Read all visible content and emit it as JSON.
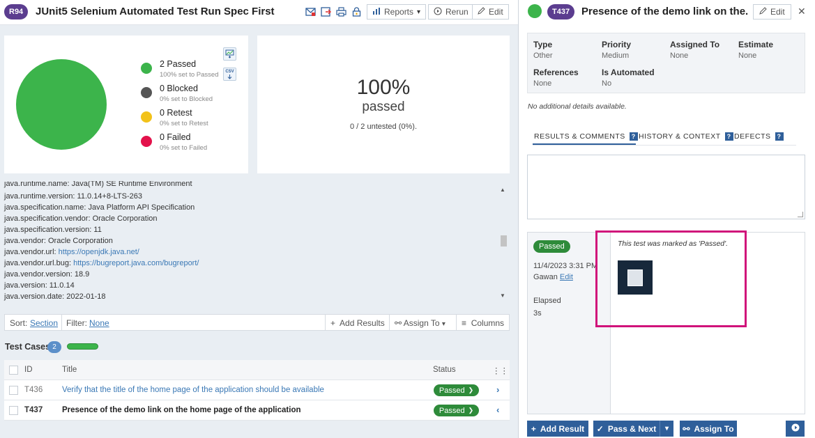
{
  "run": {
    "badge": "R94",
    "title": "JUnit5 Selenium Automated Test Run Spec First",
    "reports_label": "Reports",
    "rerun_label": "Rerun",
    "edit_label": "Edit"
  },
  "stats": {
    "legend": [
      {
        "label": "2 Passed",
        "sub": "100% set to Passed",
        "color": "#3cb44b"
      },
      {
        "label": "0 Blocked",
        "sub": "0% set to Blocked",
        "color": "#555555"
      },
      {
        "label": "0 Retest",
        "sub": "0% set to Retest",
        "color": "#f2c21a"
      },
      {
        "label": "0 Failed",
        "sub": "0% set to Failed",
        "color": "#e3124b"
      }
    ],
    "csv_label": "CSV",
    "percent": "100%",
    "percent_word": "passed",
    "untested": "0 / 2 untested (0%)."
  },
  "properties": [
    {
      "text": "java.runtime.name: Java(TM) SE Runtime Environment",
      "link": ""
    },
    {
      "text": "java.runtime.version: 11.0.14+8-LTS-263",
      "link": ""
    },
    {
      "text": "java.specification.name: Java Platform API Specification",
      "link": ""
    },
    {
      "text": "java.specification.vendor: Oracle Corporation",
      "link": ""
    },
    {
      "text": "java.specification.version: 11",
      "link": ""
    },
    {
      "text": "java.vendor: Oracle Corporation",
      "link": ""
    },
    {
      "text": "java.vendor.url: ",
      "link": "https://openjdk.java.net/"
    },
    {
      "text": "java.vendor.url.bug: ",
      "link": "https://bugreport.java.com/bugreport/"
    },
    {
      "text": "java.vendor.version: 18.9",
      "link": ""
    },
    {
      "text": "java.version: 11.0.14",
      "link": ""
    },
    {
      "text": "java.version.date: 2022-01-18",
      "link": ""
    }
  ],
  "toolbar": {
    "sort_label": "Sort:",
    "sort_value": "Section",
    "filter_label": "Filter:",
    "filter_value": "None",
    "add_results": "Add Results",
    "assign_to": "Assign To",
    "columns": "Columns"
  },
  "test_cases": {
    "title": "Test Cases",
    "count": "2",
    "progress_passed": 1.0,
    "columns": {
      "id": "ID",
      "title": "Title",
      "status": "Status"
    },
    "rows": [
      {
        "id": "T436",
        "title": "Verify that the title of the home page of the application should be available",
        "status": "Passed",
        "selected": false
      },
      {
        "id": "T437",
        "title": "Presence of the demo link on the home page of the application",
        "status": "Passed",
        "selected": true
      }
    ]
  },
  "detail": {
    "badge": "T437",
    "title": "Presence of the demo link on the...",
    "edit_label": "Edit",
    "fields": {
      "type_label": "Type",
      "type": "Other",
      "priority_label": "Priority",
      "priority": "Medium",
      "assigned_label": "Assigned To",
      "assigned": "None",
      "estimate_label": "Estimate",
      "estimate": "None",
      "references_label": "References",
      "references": "None",
      "automated_label": "Is Automated",
      "automated": "No"
    },
    "no_details": "No additional details available.",
    "tabs": [
      "RESULTS & COMMENTS",
      "HISTORY & CONTEXT",
      "DEFECTS"
    ],
    "result": {
      "status": "Passed",
      "datetime": "11/4/2023 3:31 PM",
      "user": "Gawan",
      "edit_link": "Edit",
      "elapsed_label": "Elapsed",
      "elapsed": "3s",
      "message": "This test was marked as 'Passed'."
    },
    "actions": {
      "add_result": "Add Result",
      "pass_next": "Pass & Next",
      "assign_to": "Assign To"
    }
  },
  "colors": {
    "brand_purple": "#5b3d8f",
    "passed_green": "#2e8b3a",
    "primary_blue": "#2f5f9a",
    "highlight_magenta": "#d0127a"
  }
}
